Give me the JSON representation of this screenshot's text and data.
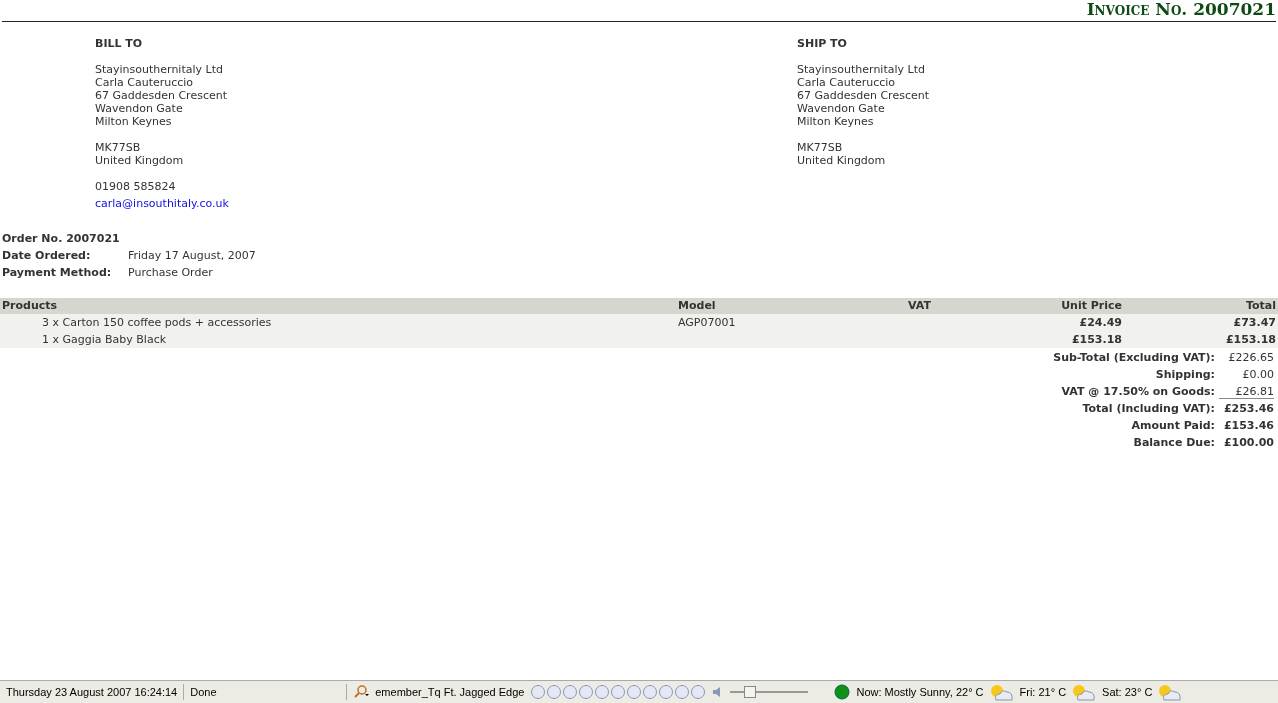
{
  "title": "Invoice No. 2007021",
  "bill_to": {
    "heading": "BILL TO",
    "address": [
      "Stayinsouthernitaly Ltd",
      "Carla Cauteruccio",
      "67 Gaddesden Crescent",
      "Wavendon Gate",
      "Milton Keynes"
    ],
    "postcode": [
      "MK77SB",
      "United Kingdom"
    ],
    "phone": "01908 585824",
    "email": "carla@insouthitaly.co.uk"
  },
  "ship_to": {
    "heading": "SHIP TO",
    "address": [
      "Stayinsouthernitaly Ltd",
      "Carla Cauteruccio",
      "67 Gaddesden Crescent",
      "Wavendon Gate",
      "Milton Keynes"
    ],
    "postcode": [
      "MK77SB",
      "United Kingdom"
    ]
  },
  "order": {
    "number": "Order No. 2007021",
    "fields": [
      {
        "label": "Date Ordered:",
        "value": "Friday 17 August, 2007"
      },
      {
        "label": "Payment Method:",
        "value": "Purchase Order"
      }
    ]
  },
  "table": {
    "columns": [
      "Products",
      "Model",
      "VAT",
      "Unit Price",
      "Total"
    ],
    "rows": [
      {
        "product": "3 x Carton 150 coffee pods + accessories",
        "model": "AGP07001",
        "unit_price": "£24.49",
        "total": "£73.47"
      },
      {
        "product": "1 x Gaggia Baby Black",
        "unit_price": "£153.18",
        "total": "£153.18"
      }
    ]
  },
  "totals": [
    {
      "label": "Sub-Total (Excluding VAT):",
      "value": "£226.65",
      "bold": false,
      "underline": false
    },
    {
      "label": "Shipping:",
      "value": "£0.00",
      "bold": false,
      "underline": false
    },
    {
      "label": "VAT @ 17.50% on Goods:",
      "value": "£26.81",
      "bold": false,
      "underline": true
    },
    {
      "label": "Total (Including VAT):",
      "value": "£253.46",
      "bold": true,
      "underline": false
    },
    {
      "label": "Amount Paid:",
      "value": "£153.46",
      "bold": true,
      "underline": false
    },
    {
      "label": "Balance Due:",
      "value": "£100.00",
      "bold": true,
      "underline": false
    }
  ],
  "status_bar": {
    "datetime": "Thursday 23 August 2007 16:24:14",
    "status": "Done",
    "track": "emember_Tq Ft. Jagged Edge",
    "volume": {
      "level": 0.2
    },
    "weather": [
      {
        "text": "Now: Mostly Sunny, 22° C"
      },
      {
        "text": "Fri: 21° C"
      },
      {
        "text": "Sat: 23° C"
      }
    ]
  }
}
